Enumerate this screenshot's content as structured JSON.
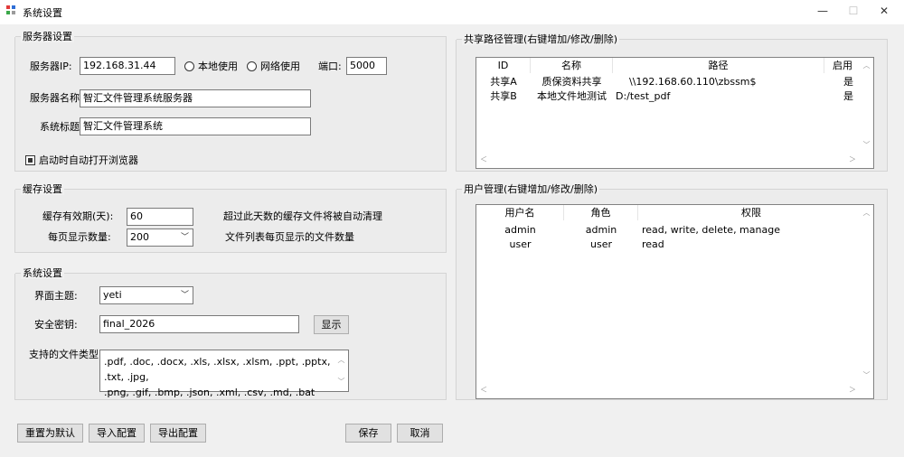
{
  "window": {
    "title": "系统设置",
    "minimize": "—",
    "maximize": "☐",
    "close": "✕"
  },
  "server": {
    "group_title": "服务器设置",
    "ip_label": "服务器IP:",
    "ip_value": "192.168.31.44",
    "radio_local": "本地使用",
    "radio_network": "网络使用",
    "port_label": "端口:",
    "port_value": "5000",
    "name_label": "服务器名称:",
    "name_value": "智汇文件管理系统服务器",
    "title_label": "系统标题:",
    "title_value": "智汇文件管理系统",
    "autostart_label": "启动时自动打开浏览器"
  },
  "cache": {
    "group_title": "缓存设置",
    "expiry_label": "缓存有效期(天):",
    "expiry_value": "60",
    "expiry_hint": "超过此天数的缓存文件将被自动清理",
    "page_label": "每页显示数量:",
    "page_value": "200",
    "page_hint": "文件列表每页显示的文件数量"
  },
  "system": {
    "group_title": "系统设置",
    "theme_label": "界面主题:",
    "theme_value": "yeti",
    "key_label": "安全密钥:",
    "key_value": "final_2026",
    "show_button": "显示",
    "types_label": "支持的文件类型:",
    "types_line1": ".pdf, .doc, .docx, .xls, .xlsx, .xlsm, .ppt, .pptx, .txt, .jpg,",
    "types_line2": ".png, .gif, .bmp, .json, .xml, .csv, .md, .bat"
  },
  "shares": {
    "group_title": "共享路径管理(右键增加/修改/删除)",
    "columns": [
      "ID",
      "名称",
      "路径",
      "启用"
    ],
    "rows": [
      {
        "id": "共享A",
        "name": "质保资料共享",
        "path": "\\\\192.168.60.110\\zbssm$",
        "enabled": "是"
      },
      {
        "id": "共享B",
        "name": "本地文件地测试",
        "path": "D:/test_pdf",
        "enabled": "是"
      }
    ]
  },
  "users": {
    "group_title": "用户管理(右键增加/修改/删除)",
    "columns": [
      "用户名",
      "角色",
      "权限"
    ],
    "rows": [
      {
        "username": "admin",
        "role": "admin",
        "perms": "read, write, delete, manage"
      },
      {
        "username": "user",
        "role": "user",
        "perms": "read"
      }
    ]
  },
  "footer": {
    "reset": "重置为默认",
    "import": "导入配置",
    "export": "导出配置",
    "save": "保存",
    "cancel": "取消"
  },
  "colors": {
    "icon_red": "#e23a3a",
    "icon_blue": "#2f6fd6",
    "icon_green": "#3ba84a",
    "icon_gray": "#9b9b9b"
  }
}
